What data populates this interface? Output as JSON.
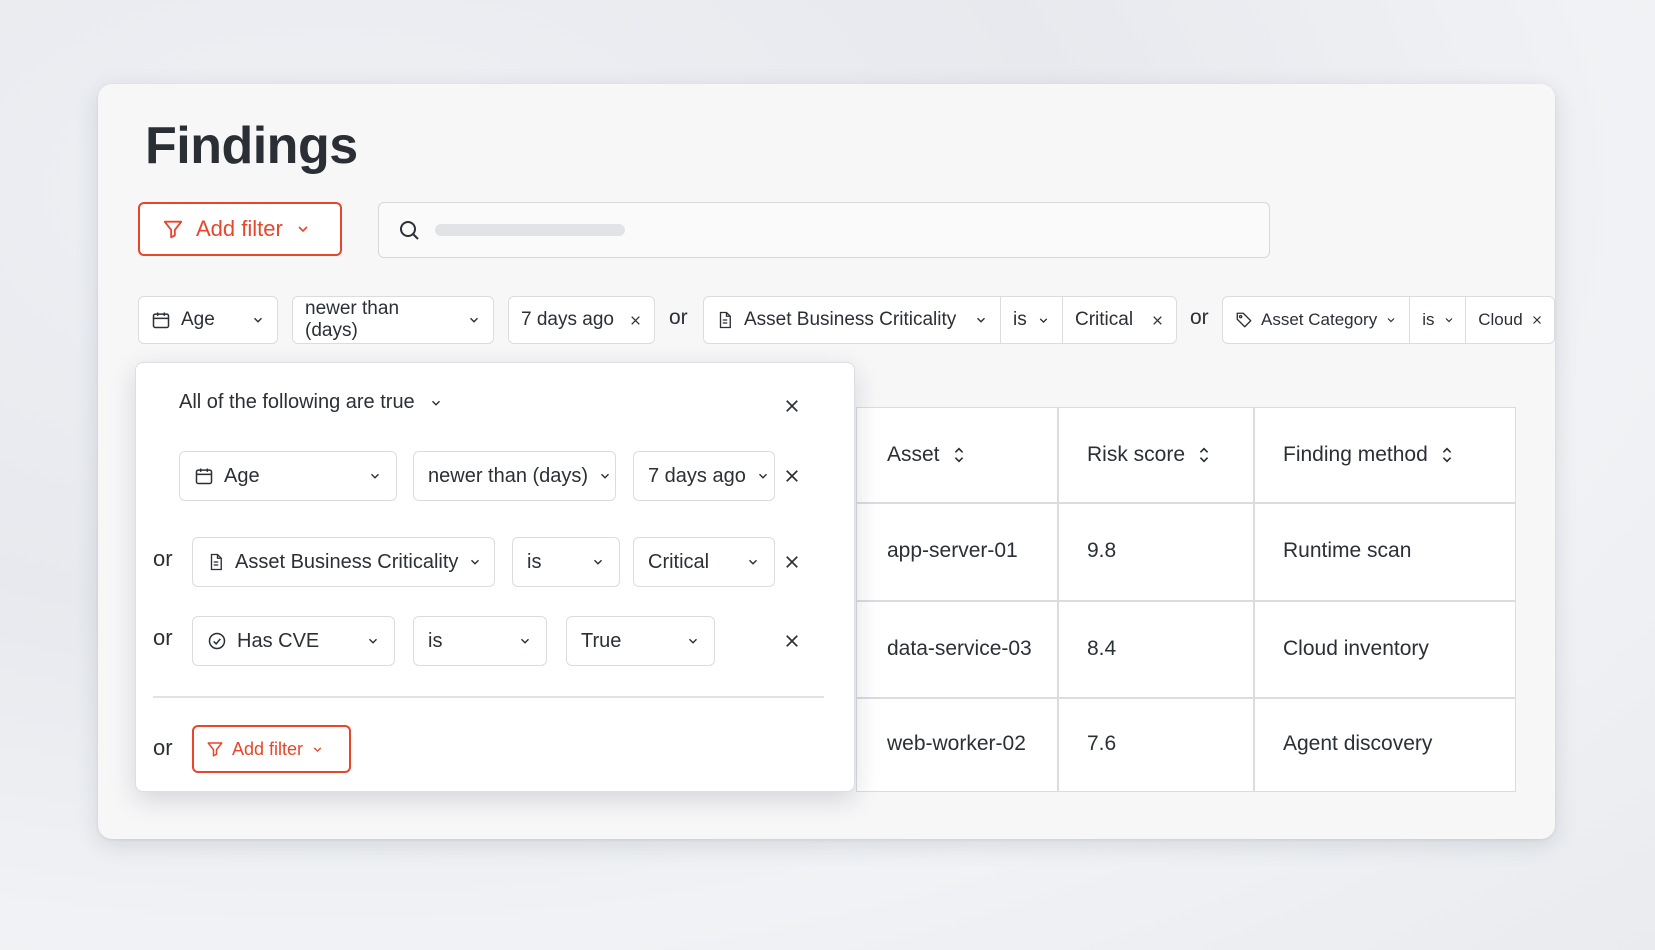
{
  "page": {
    "title": "Findings"
  },
  "toolbar": {
    "add_filter_label": "Add filter"
  },
  "search": {
    "placeholder": ""
  },
  "active_filters": {
    "connector": "or",
    "chips": [
      {
        "field": "Age",
        "field_icon": "calendar-icon",
        "operator": "newer than (days)",
        "value": "7 days ago"
      },
      {
        "field": "Asset Business Criticality",
        "field_icon": "document-icon",
        "operator": "is",
        "value": "Critical"
      },
      {
        "field": "Asset Category",
        "field_icon": "tag-icon",
        "operator": "is",
        "value": "Cloud"
      }
    ]
  },
  "popover": {
    "mode_label": "All of the following are true",
    "connector": "or",
    "rows": [
      {
        "field": "Age",
        "field_icon": "calendar-icon",
        "operator": "newer than (days)",
        "value": "7 days ago"
      },
      {
        "field": "Asset Business Criticality",
        "field_icon": "document-icon",
        "operator": "is",
        "value": "Critical"
      },
      {
        "field": "Has CVE",
        "field_icon": "check-circle-icon",
        "operator": "is",
        "value": "True"
      }
    ],
    "add_filter_label": "Add filter"
  },
  "table": {
    "columns": [
      "Asset",
      "Risk score",
      "Finding method"
    ],
    "rows": [
      [
        "app-server-01",
        "9.8",
        "Runtime scan"
      ],
      [
        "data-service-03",
        "8.4",
        "Cloud inventory"
      ],
      [
        "web-worker-02",
        "7.6",
        "Agent discovery"
      ]
    ]
  },
  "colors": {
    "accent": "#e8462a",
    "border": "#dadcdf",
    "text": "#2b2f36"
  }
}
